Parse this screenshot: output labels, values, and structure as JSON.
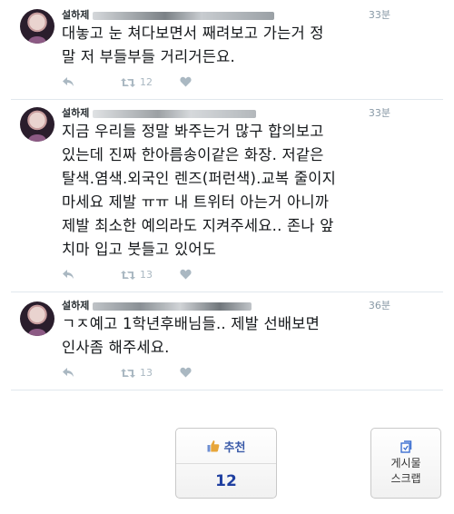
{
  "tweets": [
    {
      "name": "설하제",
      "time": "33분",
      "text": "대놓고 눈 쳐다보면서 째려보고 가는거 정\n말 저 부들부들 거리거든요.",
      "retweets": "12"
    },
    {
      "name": "설하제",
      "time": "33분",
      "text": "지금 우리들 정말 봐주는거 많구 합의보고\n있는데 진짜 한아름송이같은 화장. 저같은\n탈색.염색.외국인 렌즈(퍼런색).교복 줄이지\n마세요 제발 ㅠㅠ 내 트위터 아는거 아니까\n제발 최소한 예의라도 지켜주세요.. 존나 앞\n치마 입고 붓들고 있어도",
      "retweets": "13"
    },
    {
      "name": "설하제",
      "time": "36분",
      "text": "ㄱㅈ예고 1학년후배님들.. 제발 선배보면\n인사좀 해주세요.",
      "retweets": "13"
    }
  ],
  "recommend": {
    "label": "추천",
    "count": "12"
  },
  "scrap": {
    "line1": "게시물",
    "line2": "스크랩"
  },
  "colors": {
    "action_gray": "#aab8c2",
    "recommend_blue": "#1f3fa0",
    "divider": "#e1e8ed"
  },
  "icons": [
    "reply-icon",
    "retweet-icon",
    "heart-icon",
    "thumbs-up-icon",
    "scrap-icon"
  ]
}
